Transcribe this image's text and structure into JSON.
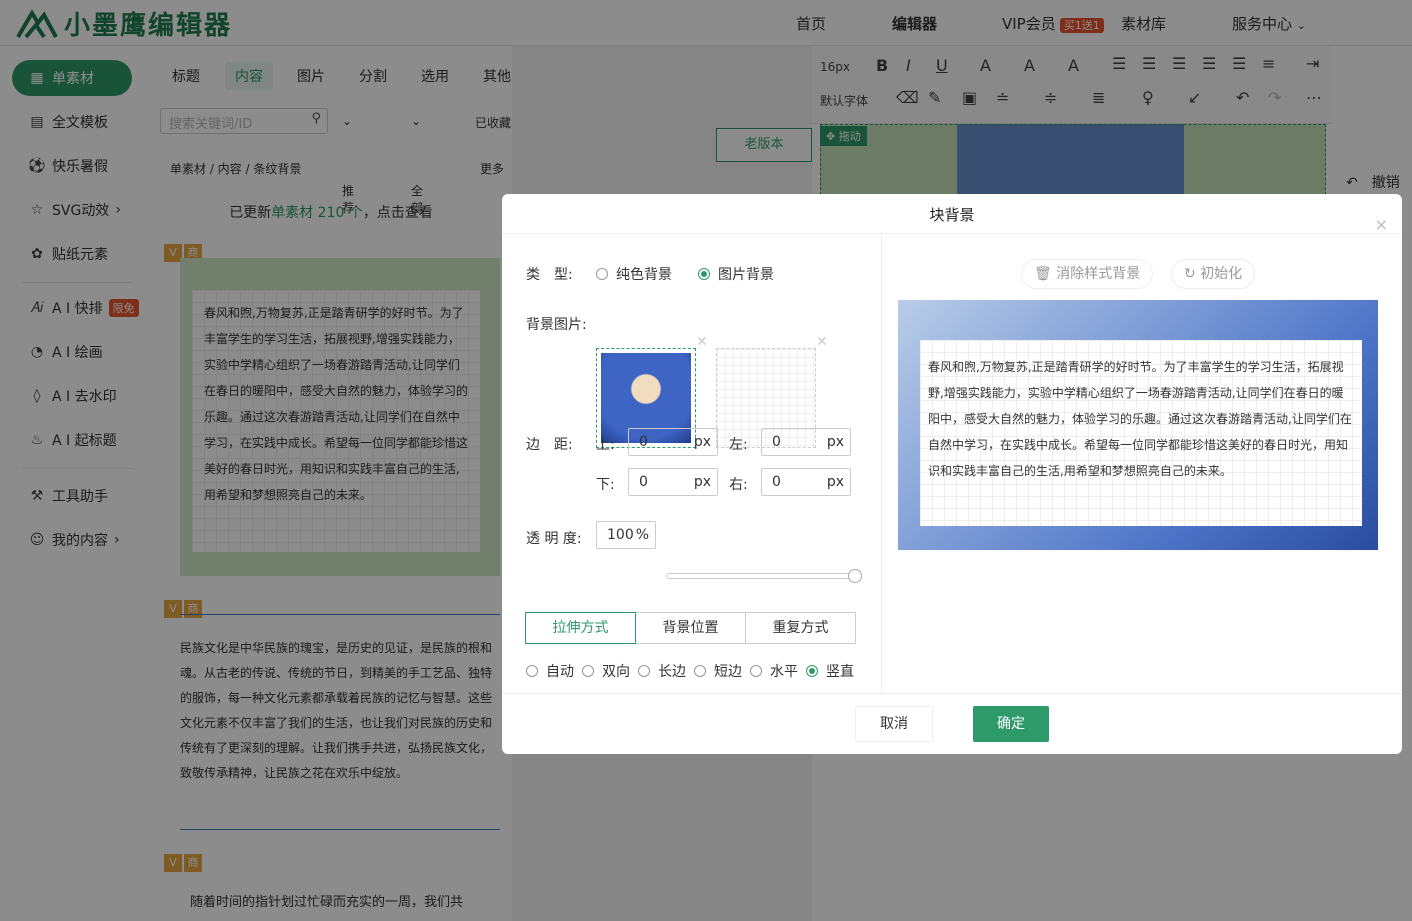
{
  "app": {
    "logo_text": "小墨鹰编辑器",
    "nav": [
      "首页",
      "编辑器",
      "VIP会员",
      "素材库",
      "服务中心"
    ],
    "vip_badge": "买1送1"
  },
  "leftnav": {
    "items": [
      "单素材",
      "全文模板",
      "快乐暑假",
      "SVG动效",
      "贴纸元素",
      "A I 快排",
      "A I 绘画",
      "A I 去水印",
      "A I 起标题",
      "工具助手",
      "我的内容"
    ],
    "free_tag": "限免"
  },
  "midpanel": {
    "tabs": [
      "标题",
      "内容",
      "图片",
      "分割",
      "选用",
      "其他"
    ],
    "search_placeholder": "搜索关键词/ID",
    "filters": [
      "推荐",
      "全部",
      "已收藏"
    ],
    "breadcrumb": "单素材 / 内容 / 条纹背景",
    "more": "更多",
    "update_prefix": "已更新",
    "update_highlight": "单素材 210 个",
    "update_suffix": "，点击查看",
    "card_tags": [
      "V",
      "商"
    ],
    "card1_text": "春风和煦,万物复苏,正是踏青研学的好时节。为了丰富学生的学习生活，拓展视野,增强实践能力，实验中学精心组织了一场春游踏青活动,让同学们在春日的暖阳中，感受大自然的魅力，体验学习的乐趣。通过这次春游踏青活动,让同学们在自然中学习，在实践中成长。希望每一位同学都能珍惜这美好的春日时光，用知识和实践丰富自己的生活,用希望和梦想照亮自己的未来。",
    "card2_text": "民族文化是中华民族的瑰宝，是历史的见证，是民族的根和魂。从古老的传说、传统的节日，到精美的手工艺品、独特的服饰，每一种文化元素都承载着民族的记忆与智慧。这些文化元素不仅丰富了我们的生活，也让我们对民族的历史和传统有了更深刻的理解。让我们携手共进，弘扬民族文化，致敬传承精神，让民族之花在欢乐中绽放。",
    "card3_text": "随着时间的指针划过忙碌而充实的一周，我们共"
  },
  "editor": {
    "old_version": "老版本",
    "font_size": "16px",
    "font_family": "默认字体",
    "drag_label": "拖动",
    "undo": "撤销"
  },
  "modal": {
    "title": "块背景",
    "type_label": "类　型:",
    "type_options": [
      "纯色背景",
      "图片背景"
    ],
    "type_selected": 1,
    "bg_image_label": "背景图片:",
    "margin_label": "边　距:",
    "top_label": "上:",
    "left_label": "左:",
    "bottom_label": "下:",
    "right_label": "右:",
    "margin_top": "0",
    "margin_left": "0",
    "margin_bottom": "0",
    "margin_right": "0",
    "unit": "px",
    "opacity_label": "透 明 度:",
    "opacity_value": "100",
    "opacity_unit": "%",
    "opacity_level": 1.0,
    "seg_tabs": [
      "拉伸方式",
      "背景位置",
      "重复方式"
    ],
    "stretch_options": [
      "自动",
      "双向",
      "长边",
      "短边",
      "水平",
      "竖直"
    ],
    "stretch_selected": 5,
    "clear_style_bg": "消除样式背景",
    "init": "初始化",
    "preview_text": "春风和煦,万物复苏,正是踏青研学的好时节。为了丰富学生的学习生活，拓展视野,增强实践能力，实验中学精心组织了一场春游踏青活动,让同学们在春日的暖阳中，感受大自然的魅力，体验学习的乐趣。通过这次春游踏青活动,让同学们在自然中学习，在实践中成长。希望每一位同学都能珍惜这美好的春日时光，用知识和实践丰富自己的生活,用希望和梦想照亮自己的未来。",
    "cancel": "取消",
    "confirm": "确定",
    "close_icon": "×"
  },
  "colors": {
    "accent": "#2e9a6a",
    "red": "#e8542e"
  }
}
